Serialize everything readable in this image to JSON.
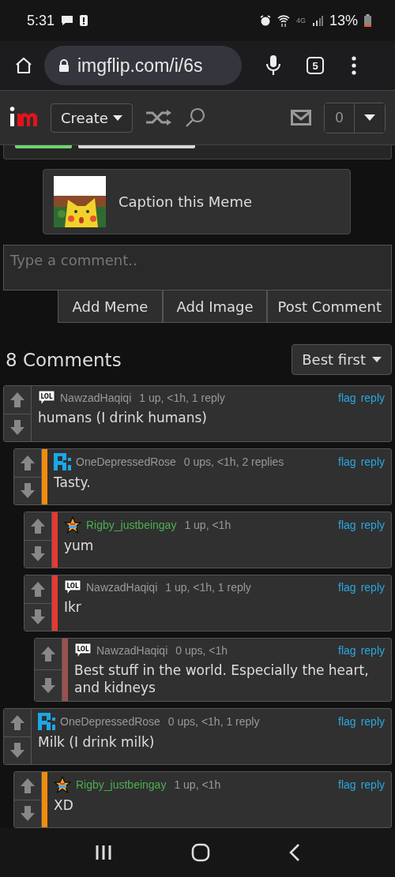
{
  "status_bar": {
    "time": "5:31",
    "network": "4G",
    "battery": "13%"
  },
  "browser": {
    "url": "imgflip.com/i/6s",
    "tab_count": "5"
  },
  "site_header": {
    "create_label": "Create",
    "notification_count": "0"
  },
  "caption_card": {
    "label": "Caption this Meme"
  },
  "comment_box": {
    "placeholder": "Type a comment..",
    "buttons": [
      "Add Meme",
      "Add Image",
      "Post Comment"
    ]
  },
  "comments_header": {
    "title": "8 Comments",
    "sort": "Best first"
  },
  "comments": [
    {
      "user": "NawzadHaqiqi",
      "kind": "lol",
      "badge_label": "LOL",
      "meta": "1 up, <1h, 1 reply",
      "text": "humans (I drink humans)",
      "actions": [
        "flag",
        "reply"
      ],
      "children": [
        {
          "user": "OneDepressedRose",
          "kind": "pixel",
          "color": "#f08c10",
          "meta": "0 ups, <1h, 2 replies",
          "text": "Tasty.",
          "actions": [
            "flag",
            "reply"
          ],
          "children": [
            {
              "user": "Rigby_justbeingay",
              "kind": "star",
              "color": "#e53935",
              "meta": "1 up, <1h",
              "text": "yum",
              "actions": [
                "flag",
                "reply"
              ]
            },
            {
              "user": "NawzadHaqiqi",
              "kind": "lol",
              "badge_label": "LOL",
              "color": "#e53935",
              "meta": "1 up, <1h, 1 reply",
              "text": "Ikr",
              "actions": [
                "flag",
                "reply"
              ],
              "children": [
                {
                  "user": "NawzadHaqiqi",
                  "kind": "lol",
                  "badge_label": "LOL",
                  "color": "#9c5050",
                  "meta": "0 ups, <1h",
                  "text": "Best stuff in the world. Especially the heart, and kidneys",
                  "actions": [
                    "flag",
                    "reply"
                  ]
                }
              ]
            }
          ]
        }
      ]
    },
    {
      "user": "OneDepressedRose",
      "kind": "pixel",
      "meta": "0 ups, <1h, 1 reply",
      "text": "Milk (I drink milk)",
      "actions": [
        "flag",
        "reply"
      ],
      "children": [
        {
          "user": "Rigby_justbeingay",
          "kind": "star",
          "color": "#f08c10",
          "meta": "1 up, <1h",
          "text": "XD",
          "actions": [
            "flag",
            "reply"
          ]
        }
      ]
    }
  ]
}
